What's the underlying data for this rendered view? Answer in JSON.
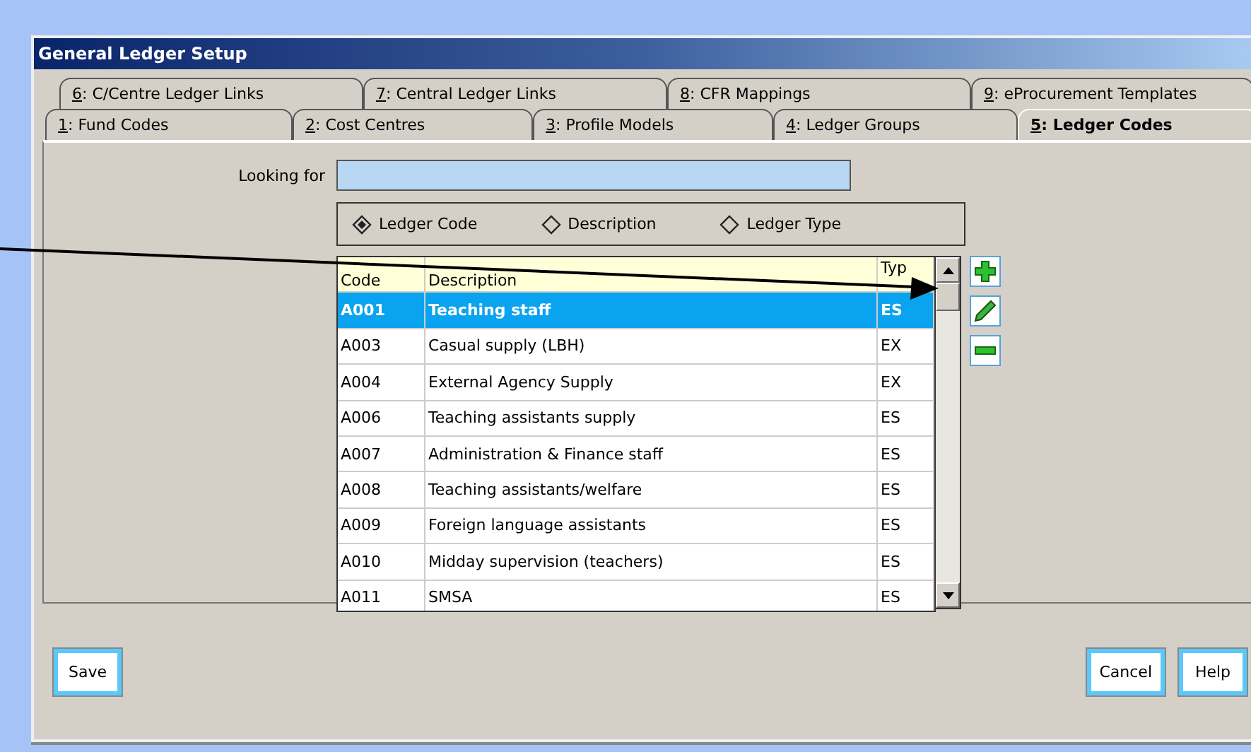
{
  "window": {
    "title": "General Ledger Setup"
  },
  "tab_rows": [
    [
      {
        "label": "6: C/Centre Ledger Links",
        "selected": false
      },
      {
        "label": "7: Central Ledger Links",
        "selected": false
      },
      {
        "label": "8: CFR Mappings",
        "selected": false
      },
      {
        "label": "9: eProcurement Templates",
        "selected": false
      }
    ],
    [
      {
        "label": "1: Fund Codes",
        "selected": false
      },
      {
        "label": "2: Cost Centres",
        "selected": false
      },
      {
        "label": "3: Profile Models",
        "selected": false
      },
      {
        "label": "4: Ledger Groups",
        "selected": false
      },
      {
        "label": "5: Ledger Codes",
        "selected": true
      }
    ]
  ],
  "search": {
    "label": "Looking for"
  },
  "search_by": [
    {
      "label": "Ledger Code",
      "selected": true
    },
    {
      "label": "Description",
      "selected": false
    },
    {
      "label": "Ledger Type",
      "selected": false
    }
  ],
  "table": {
    "columns": [
      "Code",
      "Description",
      "Typ"
    ],
    "rows": [
      {
        "cells": [
          "A001",
          "Teaching staff",
          "ES"
        ],
        "selected": true
      },
      {
        "cells": [
          "A003",
          "Casual supply (LBH)",
          "EX"
        ],
        "selected": false
      },
      {
        "cells": [
          "A004",
          "External Agency Supply",
          "EX"
        ],
        "selected": false
      },
      {
        "cells": [
          "A006",
          "Teaching assistants supply",
          "ES"
        ],
        "selected": false
      },
      {
        "cells": [
          "A007",
          "Administration & Finance staff",
          "ES"
        ],
        "selected": false
      },
      {
        "cells": [
          "A008",
          "Teaching assistants/welfare",
          "ES"
        ],
        "selected": false
      },
      {
        "cells": [
          "A009",
          "Foreign language assistants",
          "ES"
        ],
        "selected": false
      },
      {
        "cells": [
          "A010",
          "Midday supervision (teachers)",
          "ES"
        ],
        "selected": false
      },
      {
        "cells": [
          "A011",
          "SMSA",
          "ES"
        ],
        "selected": false
      }
    ]
  },
  "side_tools": [
    {
      "kind": "add"
    },
    {
      "kind": "edit"
    },
    {
      "kind": "remove"
    }
  ],
  "buttons": {
    "left": [
      "Save"
    ],
    "right": [
      "Cancel",
      "Help"
    ]
  }
}
